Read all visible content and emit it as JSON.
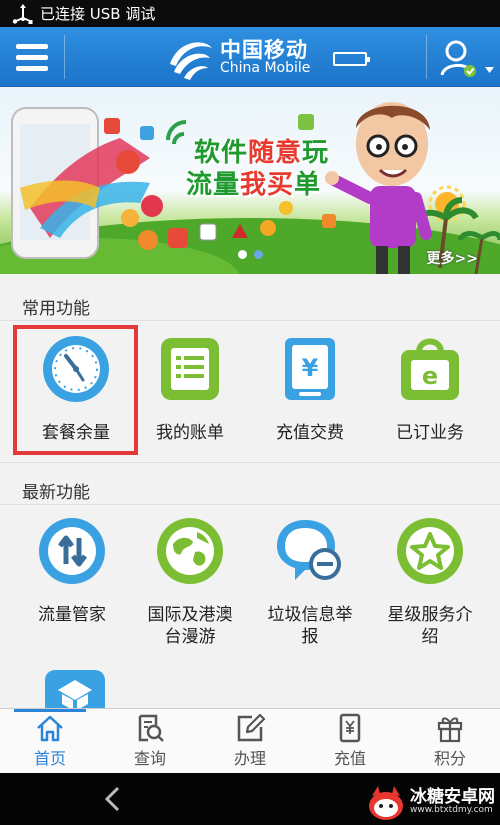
{
  "status_bar": {
    "usb_text": "已连接 USB 调试"
  },
  "header": {
    "logo_cn": "中国移动",
    "logo_en": "China Mobile",
    "brand_color": "#1f7bd0"
  },
  "banner": {
    "title_line1_a": "软件",
    "title_line1_hl": "随意",
    "title_line1_b": "玩",
    "title_line2_a": "流量",
    "title_line2_hl": "我买",
    "title_line2_b": "单",
    "more": "更多>>"
  },
  "common_features": {
    "title": "常用功能",
    "items": [
      {
        "label": "套餐余量",
        "icon": "clock-icon"
      },
      {
        "label": "我的账单",
        "icon": "bill-icon"
      },
      {
        "label": "充值交费",
        "icon": "yuan-card-icon"
      },
      {
        "label": "已订业务",
        "icon": "shopping-bag-icon"
      }
    ]
  },
  "new_features": {
    "title": "最新功能",
    "items": [
      {
        "label": "流量管家",
        "icon": "up-down-arrows-icon"
      },
      {
        "label_line1": "国际及港澳",
        "label_line2": "台漫游",
        "icon": "globe-icon"
      },
      {
        "label_line1": "垃圾信息举",
        "label_line2": "报",
        "icon": "message-block-icon"
      },
      {
        "label_line1": "星级服务介",
        "label_line2": "绍",
        "icon": "star-icon"
      }
    ]
  },
  "tabbar": {
    "tabs": [
      {
        "label": "首页",
        "icon": "home-icon",
        "active": true
      },
      {
        "label": "查询",
        "icon": "search-doc-icon",
        "active": false
      },
      {
        "label": "办理",
        "icon": "edit-icon",
        "active": false
      },
      {
        "label": "充值",
        "icon": "recharge-icon",
        "active": false
      },
      {
        "label": "积分",
        "icon": "gift-icon",
        "active": false
      }
    ]
  },
  "watermark": {
    "name": "冰糖安卓网",
    "url": "www.btxtdmy.com"
  }
}
